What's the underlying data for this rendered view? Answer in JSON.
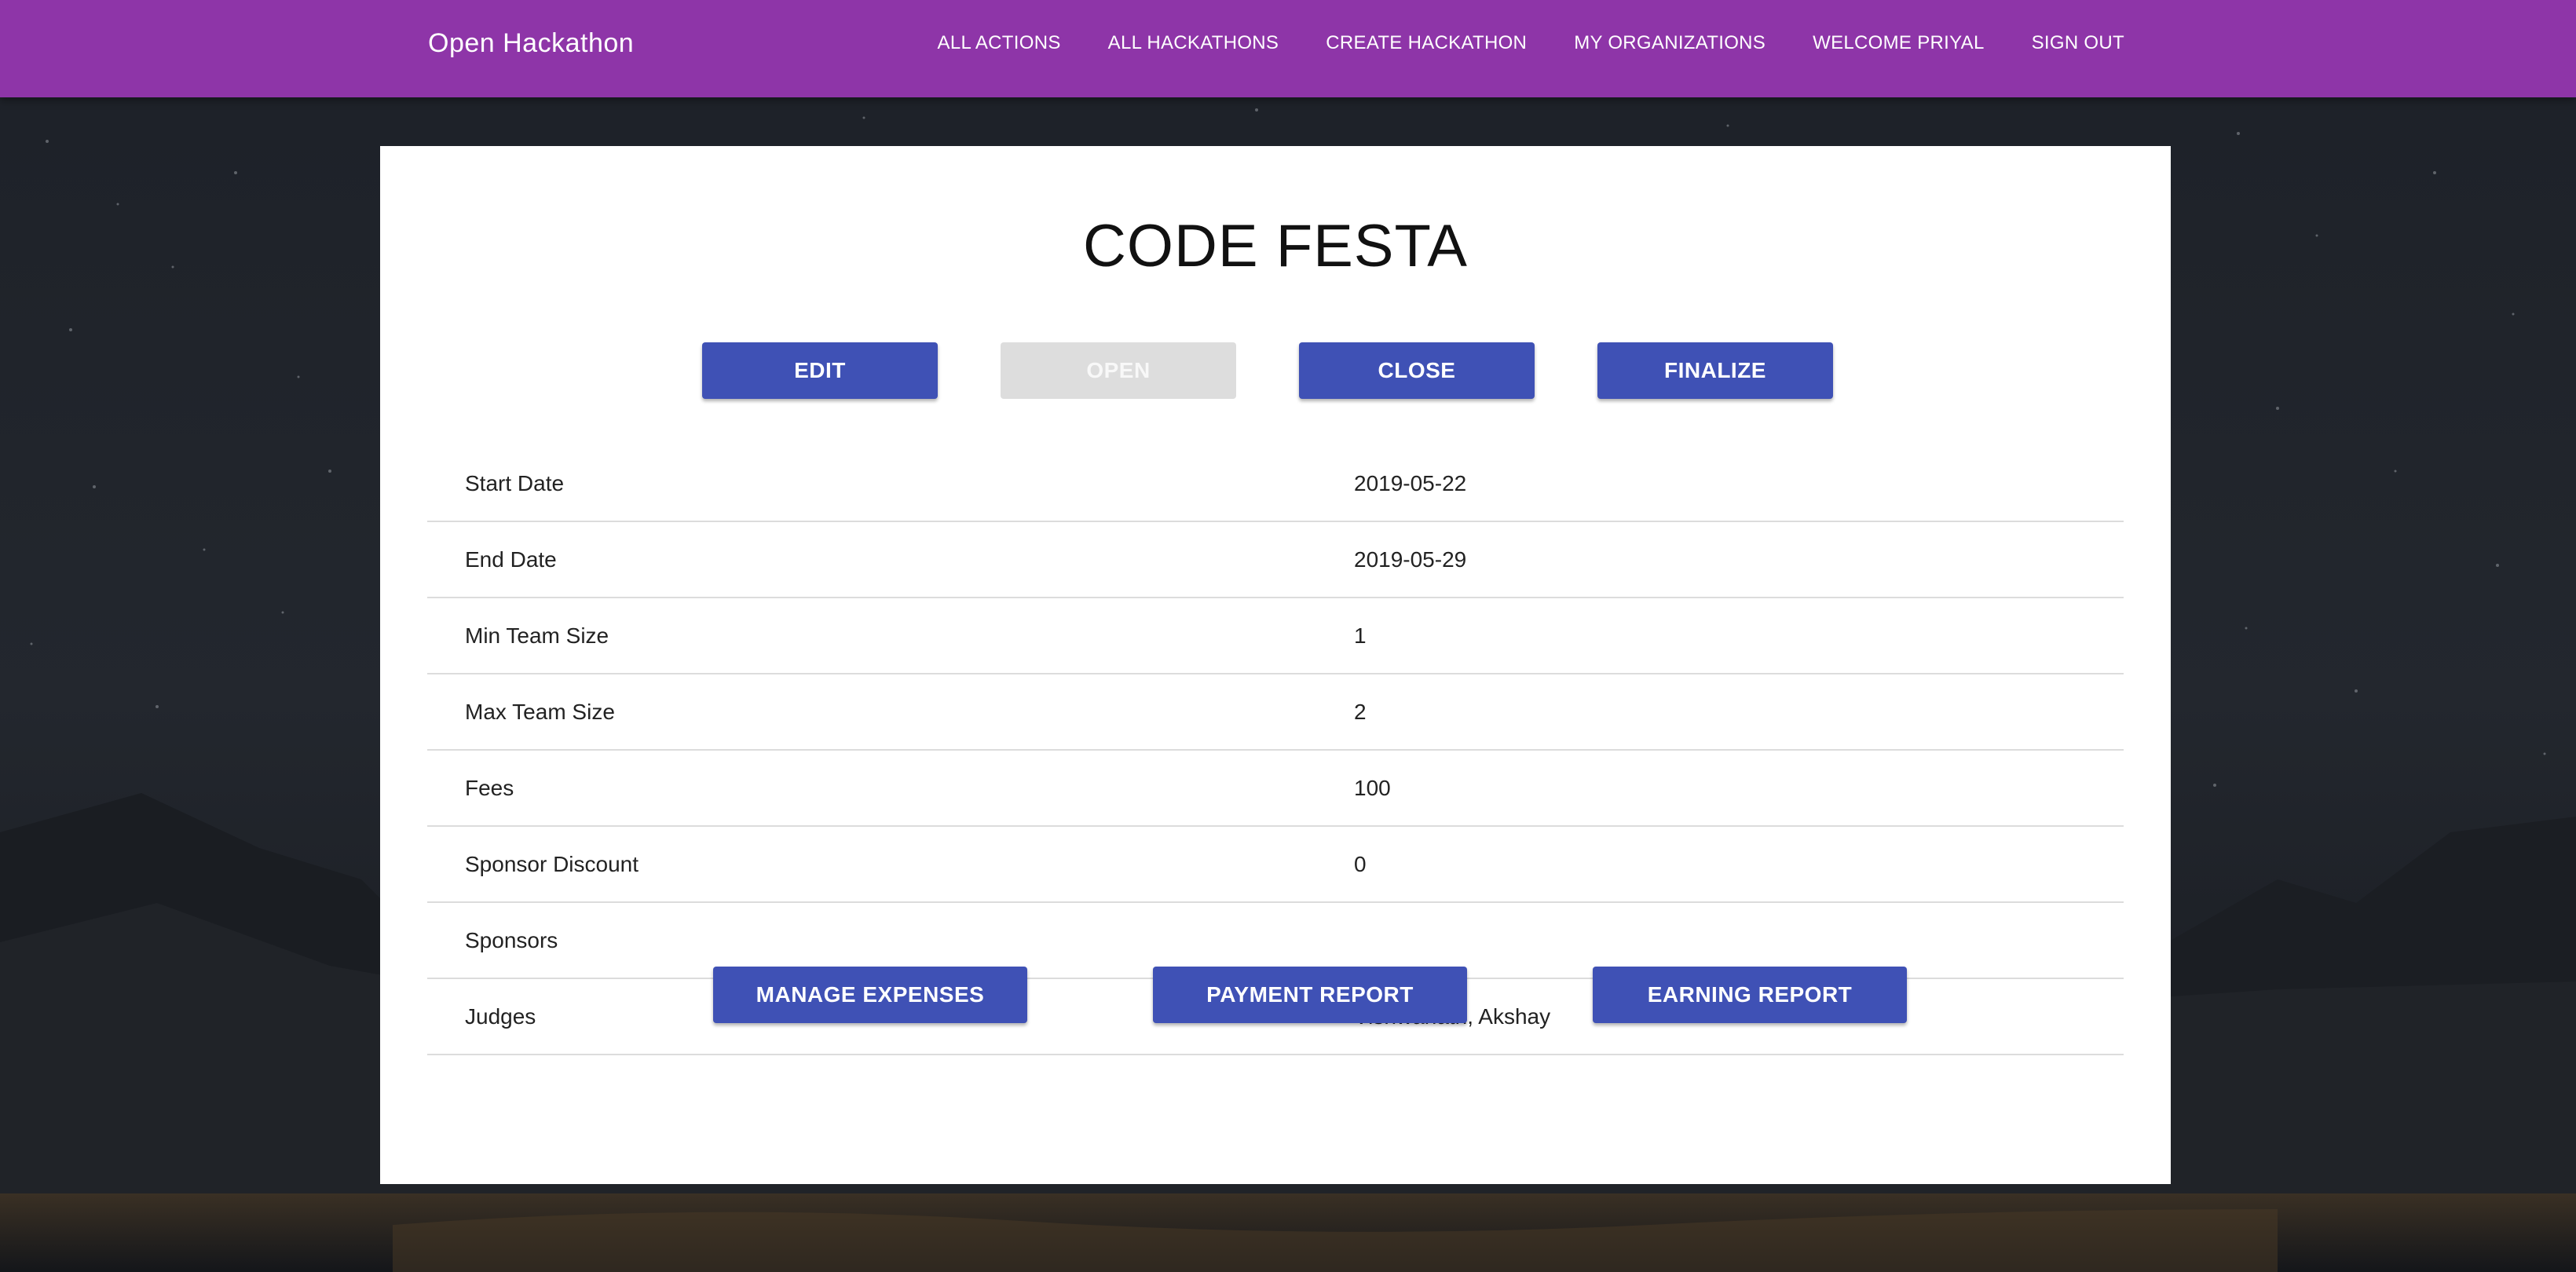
{
  "navbar": {
    "brand": "Open Hackathon",
    "links": [
      "ALL ACTIONS",
      "ALL HACKATHONS",
      "CREATE HACKATHON",
      "MY ORGANIZATIONS",
      "WELCOME PRIYAL",
      "SIGN OUT"
    ]
  },
  "hackathon": {
    "title": "CODE FESTA",
    "actions": {
      "edit": "EDIT",
      "open": "OPEN",
      "close": "CLOSE",
      "finalize": "FINALIZE"
    },
    "details": [
      {
        "label": "Start Date",
        "value": "2019-05-22"
      },
      {
        "label": "End Date",
        "value": "2019-05-29"
      },
      {
        "label": "Min Team Size",
        "value": "1"
      },
      {
        "label": "Max Team Size",
        "value": "2"
      },
      {
        "label": "Fees",
        "value": "100"
      },
      {
        "label": "Sponsor Discount",
        "value": "0"
      },
      {
        "label": "Sponsors",
        "value": ""
      },
      {
        "label": "Judges",
        "value": "Vishwanath, Akshay"
      }
    ],
    "reports": {
      "manage_expenses": "MANAGE EXPENSES",
      "payment_report": "PAYMENT REPORT",
      "earning_report": "EARNING REPORT"
    }
  },
  "colors": {
    "navbar": "#8e35a8",
    "primary_button": "#3f51b5",
    "disabled_button": "#dddddd"
  }
}
